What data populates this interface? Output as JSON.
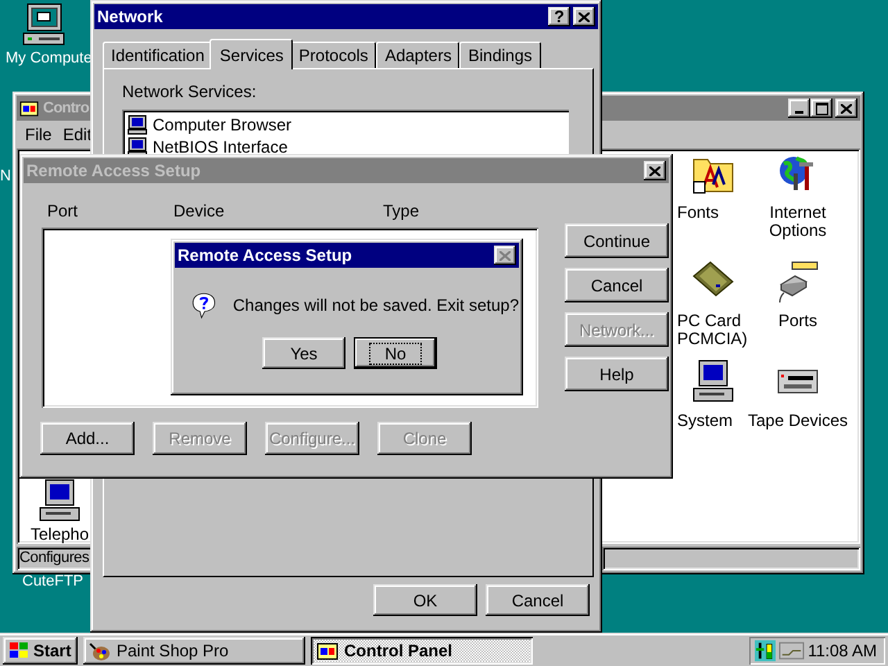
{
  "desktop_icons": [
    {
      "label": "My Compute",
      "kind": "computer"
    },
    {
      "label": "N",
      "kind": "none"
    },
    {
      "label": "CuteFTP",
      "kind": "none"
    }
  ],
  "control_panel": {
    "title": "Contro",
    "menu": [
      "File",
      "Edit"
    ],
    "status": "Configures",
    "icons": [
      {
        "lines": [
          "Fonts"
        ],
        "kind": "fonts"
      },
      {
        "lines": [
          "Internet",
          "Options"
        ],
        "kind": "internet"
      },
      {
        "lines": [
          "PC Card",
          "PCMCIA)"
        ],
        "kind": "pccard"
      },
      {
        "lines": [
          "Ports"
        ],
        "kind": "ports"
      },
      {
        "lines": [
          "System"
        ],
        "kind": "system"
      },
      {
        "lines": [
          "Tape Devices"
        ],
        "kind": "tape"
      },
      {
        "lines": [
          "Telepho"
        ],
        "kind": "telephony"
      }
    ]
  },
  "network": {
    "title": "Network",
    "help": "?",
    "tabs": [
      {
        "label": "Identification",
        "selected": false
      },
      {
        "label": "Services",
        "selected": true
      },
      {
        "label": "Protocols",
        "selected": false
      },
      {
        "label": "Adapters",
        "selected": false
      },
      {
        "label": "Bindings",
        "selected": false
      }
    ],
    "services_label": "Network Services:",
    "services": [
      "Computer Browser",
      "NetBIOS Interface"
    ],
    "buttons": [
      "OK",
      "Cancel"
    ]
  },
  "remote_access": {
    "title": "Remote Access Setup",
    "columns": [
      "Port",
      "Device",
      "Type"
    ],
    "side_buttons": [
      {
        "label": "Continue",
        "disabled": false
      },
      {
        "label": "Cancel",
        "disabled": false
      },
      {
        "label": "Network...",
        "disabled": true
      },
      {
        "label": "Help",
        "disabled": false
      }
    ],
    "bottom_buttons": [
      {
        "label": "Add...",
        "disabled": false
      },
      {
        "label": "Remove",
        "disabled": true
      },
      {
        "label": "Configure...",
        "disabled": true
      },
      {
        "label": "Clone",
        "disabled": true
      }
    ]
  },
  "message_box": {
    "title": "Remote Access Setup",
    "text": "Changes will not be saved. Exit setup?",
    "close_disabled": true,
    "buttons": [
      {
        "label": "Yes",
        "default": false
      },
      {
        "label": "No",
        "default": true
      }
    ]
  },
  "taskbar": {
    "start": "Start",
    "tasks": [
      {
        "label": "Paint Shop Pro",
        "selected": false,
        "kind": "paint"
      },
      {
        "label": "Control Panel",
        "selected": true,
        "kind": "control"
      }
    ],
    "clock": "11:08 AM"
  }
}
